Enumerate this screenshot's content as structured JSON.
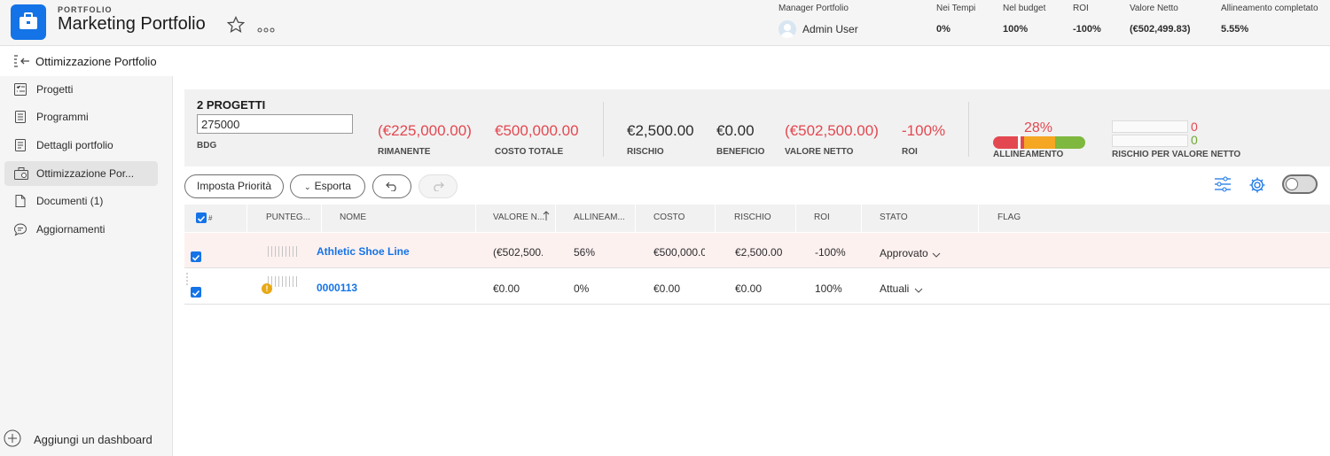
{
  "header": {
    "kicker": "PORTFOLIO",
    "title": "Marketing Portfolio",
    "manager_label": "Manager Portfolio",
    "manager_name": "Admin User",
    "stats": [
      {
        "label": "Nei Tempi",
        "value": "0%"
      },
      {
        "label": "Nel budget",
        "value": "100%"
      },
      {
        "label": "ROI",
        "value": "-100%"
      },
      {
        "label": "Valore Netto",
        "value": "(€502,499.83)"
      },
      {
        "label": "Allineamento completato",
        "value": "5.55%"
      }
    ]
  },
  "subheader": {
    "title": "Ottimizzazione Portfolio"
  },
  "sidebar": {
    "items": [
      {
        "label": "Progetti",
        "icon": "projects-icon"
      },
      {
        "label": "Programmi",
        "icon": "programs-icon"
      },
      {
        "label": "Dettagli portfolio",
        "icon": "details-icon"
      },
      {
        "label": "Ottimizzazione Por...",
        "icon": "optimizer-icon",
        "active": true
      },
      {
        "label": "Documenti (1)",
        "icon": "document-icon"
      },
      {
        "label": "Aggiornamenti",
        "icon": "updates-icon"
      }
    ],
    "add_dashboard": "Aggiungi un dashboard"
  },
  "summary": {
    "count": "2 PROGETTI",
    "budget_value": "275000",
    "budget_label": "BDG",
    "metrics": [
      {
        "value": "(€225,000.00)",
        "label": "RIMANENTE",
        "color": "#e34850"
      },
      {
        "value": "€500,000.00",
        "label": "COSTO TOTALE",
        "color": "#e34850"
      },
      {
        "value": "€2,500.00",
        "label": "RISCHIO",
        "color": "#2c2c2c"
      },
      {
        "value": "€0.00",
        "label": "BENEFICIO",
        "color": "#2c2c2c"
      },
      {
        "value": "(€502,500.00)",
        "label": "VALORE NETTO",
        "color": "#e34850"
      },
      {
        "value": "-100%",
        "label": "ROI",
        "color": "#e34850"
      }
    ],
    "alignment_value": "28%",
    "alignment_level": 0.28,
    "alignment_label": "ALLINEAMENTO",
    "risk_values": [
      "0",
      "0"
    ],
    "risk_colors": [
      "#e34850",
      "#6ea832"
    ],
    "risk_label": "RISCHIO PER VALORE NETTO"
  },
  "toolbar": {
    "set_priority": "Imposta Priorità",
    "export": "Esporta"
  },
  "table": {
    "columns": [
      "#",
      "PUNTEG...",
      "NOME",
      "VALORE N...",
      "ALLINEAM...",
      "COSTO",
      "RISCHIO",
      "ROI",
      "STATO",
      "FLAG"
    ],
    "rows": [
      {
        "name": "Athletic Shoe Line",
        "net_value": "(€502,500.(",
        "alignment": "56%",
        "cost": "€500,000.0(",
        "risk": "€2,500.00",
        "roi": "-100%",
        "status": "Approvato",
        "warning": false
      },
      {
        "name": "0000113",
        "net_value": "€0.00",
        "alignment": "0%",
        "cost": "€0.00",
        "risk": "€0.00",
        "roi": "100%",
        "status": "Attuali",
        "warning": true
      }
    ]
  }
}
